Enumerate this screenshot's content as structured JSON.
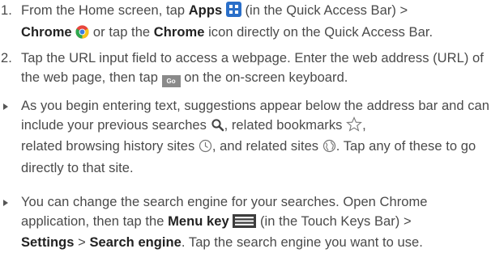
{
  "steps": [
    {
      "number": "1.",
      "t1": "From the Home screen, tap ",
      "apps": "Apps",
      "t2": " (in the Quick Access Bar) >",
      "chrome1": "Chrome",
      "t3": " or tap the ",
      "chrome2": "Chrome",
      "t4": " icon directly on the Quick Access Bar."
    },
    {
      "number": "2.",
      "t1": "Tap the URL input field to access a webpage. Enter the web address (URL) of the web page, then tap ",
      "go_key": "Go",
      "t2": " on the on-screen keyboard."
    }
  ],
  "bullets": [
    {
      "t1": "As you begin entering text, suggestions appear below the address bar and can include your previous searches ",
      "t2": ", related bookmarks ",
      "t3": ",",
      "t4": "related browsing history sites ",
      "t5": ", and related sites ",
      "t6": ". Tap any of these to go directly to that site."
    },
    {
      "t1": "You can change the search engine for your searches. Open Chrome application, then tap the ",
      "menu_key": "Menu key",
      "t2": " (in the Touch Keys Bar) >",
      "settings": "Settings",
      "sep": " > ",
      "search_engine": "Search engine",
      "t3": ". Tap the search engine you want to use."
    }
  ],
  "icons": {
    "apps": "apps-grid-icon",
    "chrome": "chrome-logo-icon",
    "go": "go-key-icon",
    "search": "search-icon",
    "bookmark": "star-outline-icon",
    "history": "clock-icon",
    "site": "globe-icon",
    "menu": "menu-key-icon"
  },
  "colors": {
    "text": "#4a4a4a",
    "bold": "#222222",
    "apps_icon": "#2a6fc9",
    "go_key": "#8a8a8a"
  }
}
